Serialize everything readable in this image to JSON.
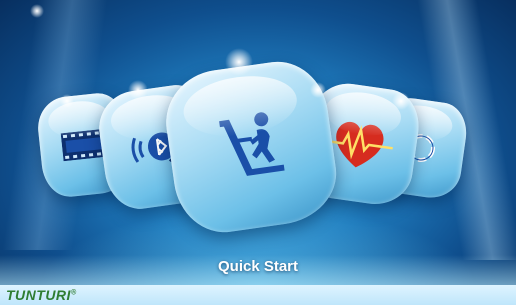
{
  "menu": {
    "items": [
      {
        "id": "movie",
        "icon": "film-strip-icon"
      },
      {
        "id": "music",
        "icon": "bluetooth-speaker-icon"
      },
      {
        "id": "quick_start",
        "icon": "treadmill-runner-icon"
      },
      {
        "id": "heart_rate",
        "icon": "heartbeat-icon"
      },
      {
        "id": "program",
        "icon": "circular-arrows-icon"
      }
    ],
    "selected_label": "Quick Start"
  },
  "brand": {
    "logo": "TUNTURI",
    "reg": "®"
  },
  "colors": {
    "background": "#1f7bbd",
    "icon_blue": "#1a4fa8",
    "heart_red": "#d62c1f",
    "brand_green": "#2e7d32"
  }
}
